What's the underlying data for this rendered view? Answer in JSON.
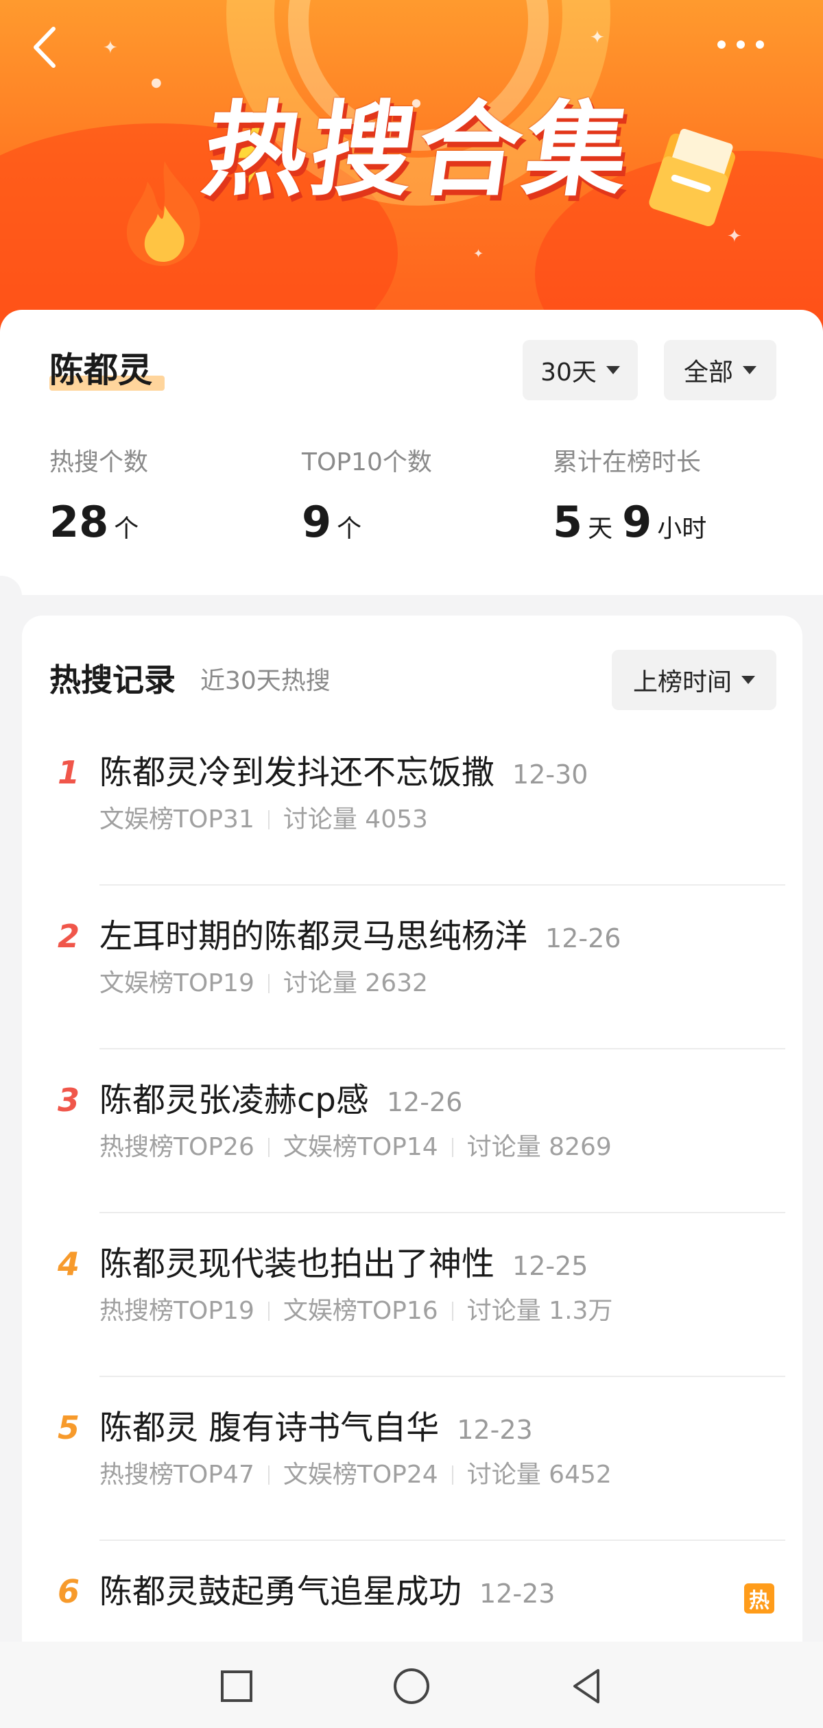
{
  "banner": {
    "title": "热搜合集",
    "colors": {
      "top": "#ff9a2e",
      "bottom": "#ff5d1c",
      "shadow": "#e2361a"
    }
  },
  "profile": {
    "name": "陈都灵",
    "filters": {
      "period": "30天",
      "category": "全部"
    }
  },
  "stats": [
    {
      "label": "热搜个数",
      "value": "28",
      "unit": "个"
    },
    {
      "label": "TOP10个数",
      "value": "9",
      "unit": "个"
    },
    {
      "label": "累计在榜时长",
      "value_days": "5",
      "unit_days": "天",
      "value_hours": "9",
      "unit_hours": "小时"
    }
  ],
  "records": {
    "title": "热搜记录",
    "subtitle": "近30天热搜",
    "sort_label": "上榜时间",
    "items": [
      {
        "rank": "1",
        "title": "陈都灵冷到发抖还不忘饭撒",
        "date": "12-30",
        "meta": [
          "文娱榜TOP31",
          "讨论量 4053"
        ]
      },
      {
        "rank": "2",
        "title": "左耳时期的陈都灵马思纯杨洋",
        "date": "12-26",
        "meta": [
          "文娱榜TOP19",
          "讨论量 2632"
        ]
      },
      {
        "rank": "3",
        "title": "陈都灵张凌赫cp感",
        "date": "12-26",
        "meta": [
          "热搜榜TOP26",
          "文娱榜TOP14",
          "讨论量 8269"
        ]
      },
      {
        "rank": "4",
        "title": "陈都灵现代装也拍出了神性",
        "date": "12-25",
        "meta": [
          "热搜榜TOP19",
          "文娱榜TOP16",
          "讨论量 1.3万"
        ]
      },
      {
        "rank": "5",
        "title": "陈都灵 腹有诗书气自华",
        "date": "12-23",
        "meta": [
          "热搜榜TOP47",
          "文娱榜TOP24",
          "讨论量 6452"
        ]
      },
      {
        "rank": "6",
        "title": "陈都灵鼓起勇气追星成功",
        "date": "12-23",
        "badge": "热",
        "meta": []
      }
    ],
    "rank_colors": [
      "#f0564a",
      "#f0564a",
      "#f0564a",
      "#f79a2b",
      "#f79a2b",
      "#f79a2b"
    ]
  },
  "nav": {
    "icons": [
      "square-icon",
      "circle-icon",
      "triangle-back-icon"
    ]
  }
}
